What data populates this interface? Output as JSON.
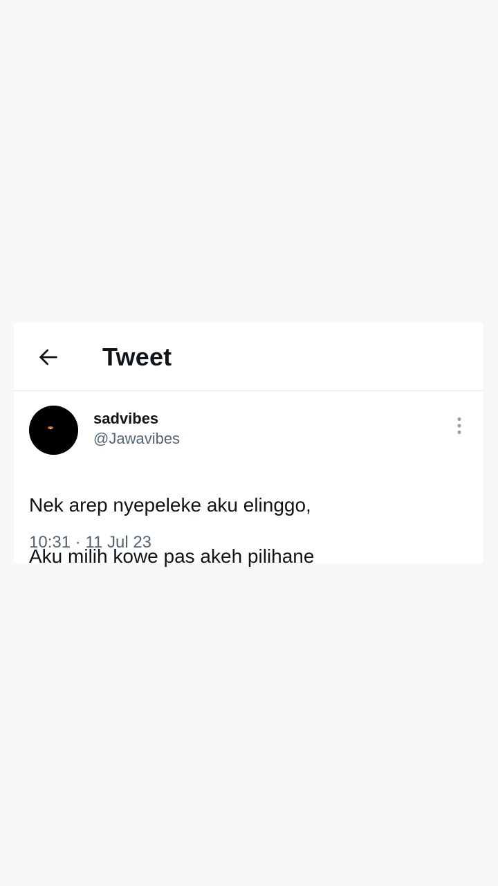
{
  "header": {
    "back_icon": "arrow-left-icon",
    "title": "Tweet"
  },
  "tweet": {
    "author": {
      "display_name": "sadvibes",
      "handle": "@Jawavibes",
      "avatar": "profile-avatar"
    },
    "more_icon": "more-vertical-icon",
    "text_line1": "Nek arep nyepeleke aku elinggo,",
    "text_line2": "Aku milih kowe pas akeh pilihane",
    "timestamp": "10:31 · 11 Jul 23"
  },
  "colors": {
    "background": "#f7f7f7",
    "card": "#ffffff",
    "primary_text": "#0f1419",
    "secondary_text": "#536471",
    "divider": "#e6e9eb"
  }
}
